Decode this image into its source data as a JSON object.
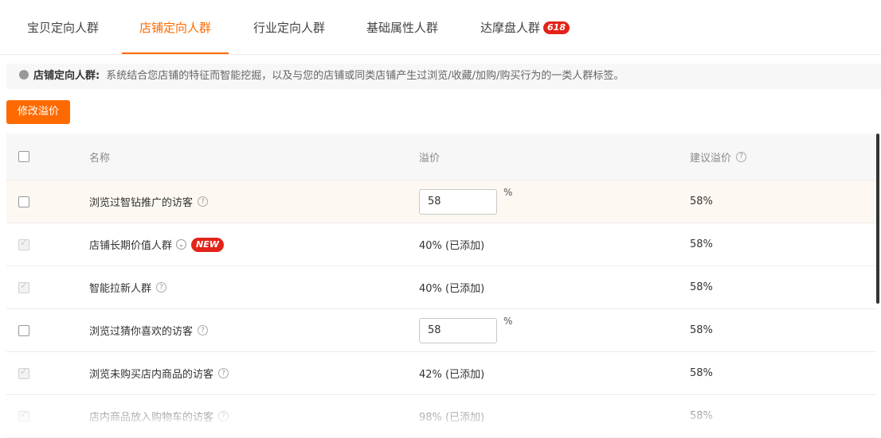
{
  "tabs": [
    {
      "label": "宝贝定向人群"
    },
    {
      "label": "店铺定向人群"
    },
    {
      "label": "行业定向人群"
    },
    {
      "label": "基础属性人群"
    },
    {
      "label": "达摩盘人群",
      "badge": "618"
    }
  ],
  "active_tab": "店铺定向人群",
  "notice": {
    "title": "店铺定向人群:",
    "text": "系统结合您店铺的特征而智能挖掘，以及与您的店铺或同类店铺产生过浏览/收藏/加购/购买行为的一类人群标签。"
  },
  "modify_button": "修改溢价",
  "table": {
    "headers": {
      "name": "名称",
      "bid": "溢价",
      "suggested": "建议溢价"
    },
    "rows": [
      {
        "name": "浏览过智钻推广的访客",
        "input_value": "58",
        "unit": "%",
        "suggested": "58%"
      },
      {
        "name": "店铺长期价值人群",
        "badge": "NEW",
        "bid_text": "40% (已添加)",
        "suggested": "58%"
      },
      {
        "name": "智能拉新人群",
        "bid_text": "40% (已添加)",
        "suggested": "58%"
      },
      {
        "name": "浏览过猜你喜欢的访客",
        "input_value": "58",
        "unit": "%",
        "suggested": "58%"
      },
      {
        "name": "浏览未购买店内商品的访客",
        "bid_text": "42% (已添加)",
        "suggested": "58%"
      },
      {
        "name": "店内商品放入购物车的访客",
        "bid_text": "98% (已添加)",
        "suggested": "58%"
      }
    ]
  },
  "colors": {
    "accent": "#ff6a00",
    "badge": "#e2231a"
  }
}
